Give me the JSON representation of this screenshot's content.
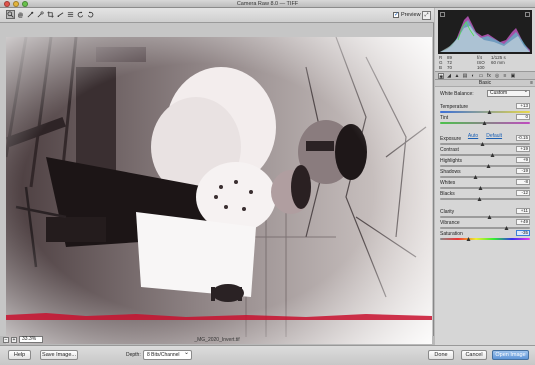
{
  "window": {
    "title": "Camera Raw 8.0 — TIFF"
  },
  "toolbar": {
    "tools": [
      "zoom-icon",
      "hand-icon",
      "eyedropper-icon",
      "crop-icon",
      "straighten-icon",
      "list-icon",
      "rotate-ccw-icon",
      "rotate-cw-icon"
    ],
    "preview_label": "Preview",
    "preview_checked": true
  },
  "readout": {
    "r_label": "R",
    "r_value": "89",
    "g_label": "G",
    "g_value": "72",
    "b_label": "B",
    "b_value": "70",
    "aperture": "f/4",
    "shutter": "1/125 s",
    "iso": "ISO 100",
    "focal": "60 mm"
  },
  "panel": {
    "section_title": "Basic",
    "white_balance_label": "White Balance:",
    "white_balance_value": "Custom",
    "auto_label": "Auto",
    "default_label": "Default",
    "sliders": [
      {
        "label": "Temperature",
        "value": "+13",
        "position": 0.56,
        "gradient": "linear-gradient(90deg,#3b6fd8,#e8d84a)"
      },
      {
        "label": "Tint",
        "value": "0",
        "position": 0.5,
        "gradient": "linear-gradient(90deg,#4bc24b,#c04bc0)"
      },
      {
        "label": "Exposure",
        "value": "-0.15",
        "position": 0.48
      },
      {
        "label": "Contrast",
        "value": "+19",
        "position": 0.59
      },
      {
        "label": "Highlights",
        "value": "+9",
        "position": 0.54
      },
      {
        "label": "Shadows",
        "value": "-19",
        "position": 0.4
      },
      {
        "label": "Whites",
        "value": "-8",
        "position": 0.46
      },
      {
        "label": "Blacks",
        "value": "-12",
        "position": 0.44
      },
      {
        "label": "Clarity",
        "value": "+11",
        "position": 0.55
      },
      {
        "label": "Vibrance",
        "value": "+49",
        "position": 0.74
      },
      {
        "label": "Saturation",
        "value": "-35",
        "position": 0.32,
        "gradient": "linear-gradient(90deg,#888,#e33,#ee3,#3e3,#33e,#e3e)",
        "active": true
      }
    ]
  },
  "zoom": {
    "value": "33.3%"
  },
  "file": {
    "name": "_MG_2020_Invert.tif"
  },
  "bottom": {
    "help_label": "Help",
    "save_label": "Save Image...",
    "depth_label": "Depth:",
    "depth_value": "8 Bits/Channel",
    "done_label": "Done",
    "cancel_label": "Cancel",
    "open_label": "Open Image"
  },
  "colors": {
    "accent": "#5f96d8",
    "histogram_bg": "#1e1e1e"
  }
}
